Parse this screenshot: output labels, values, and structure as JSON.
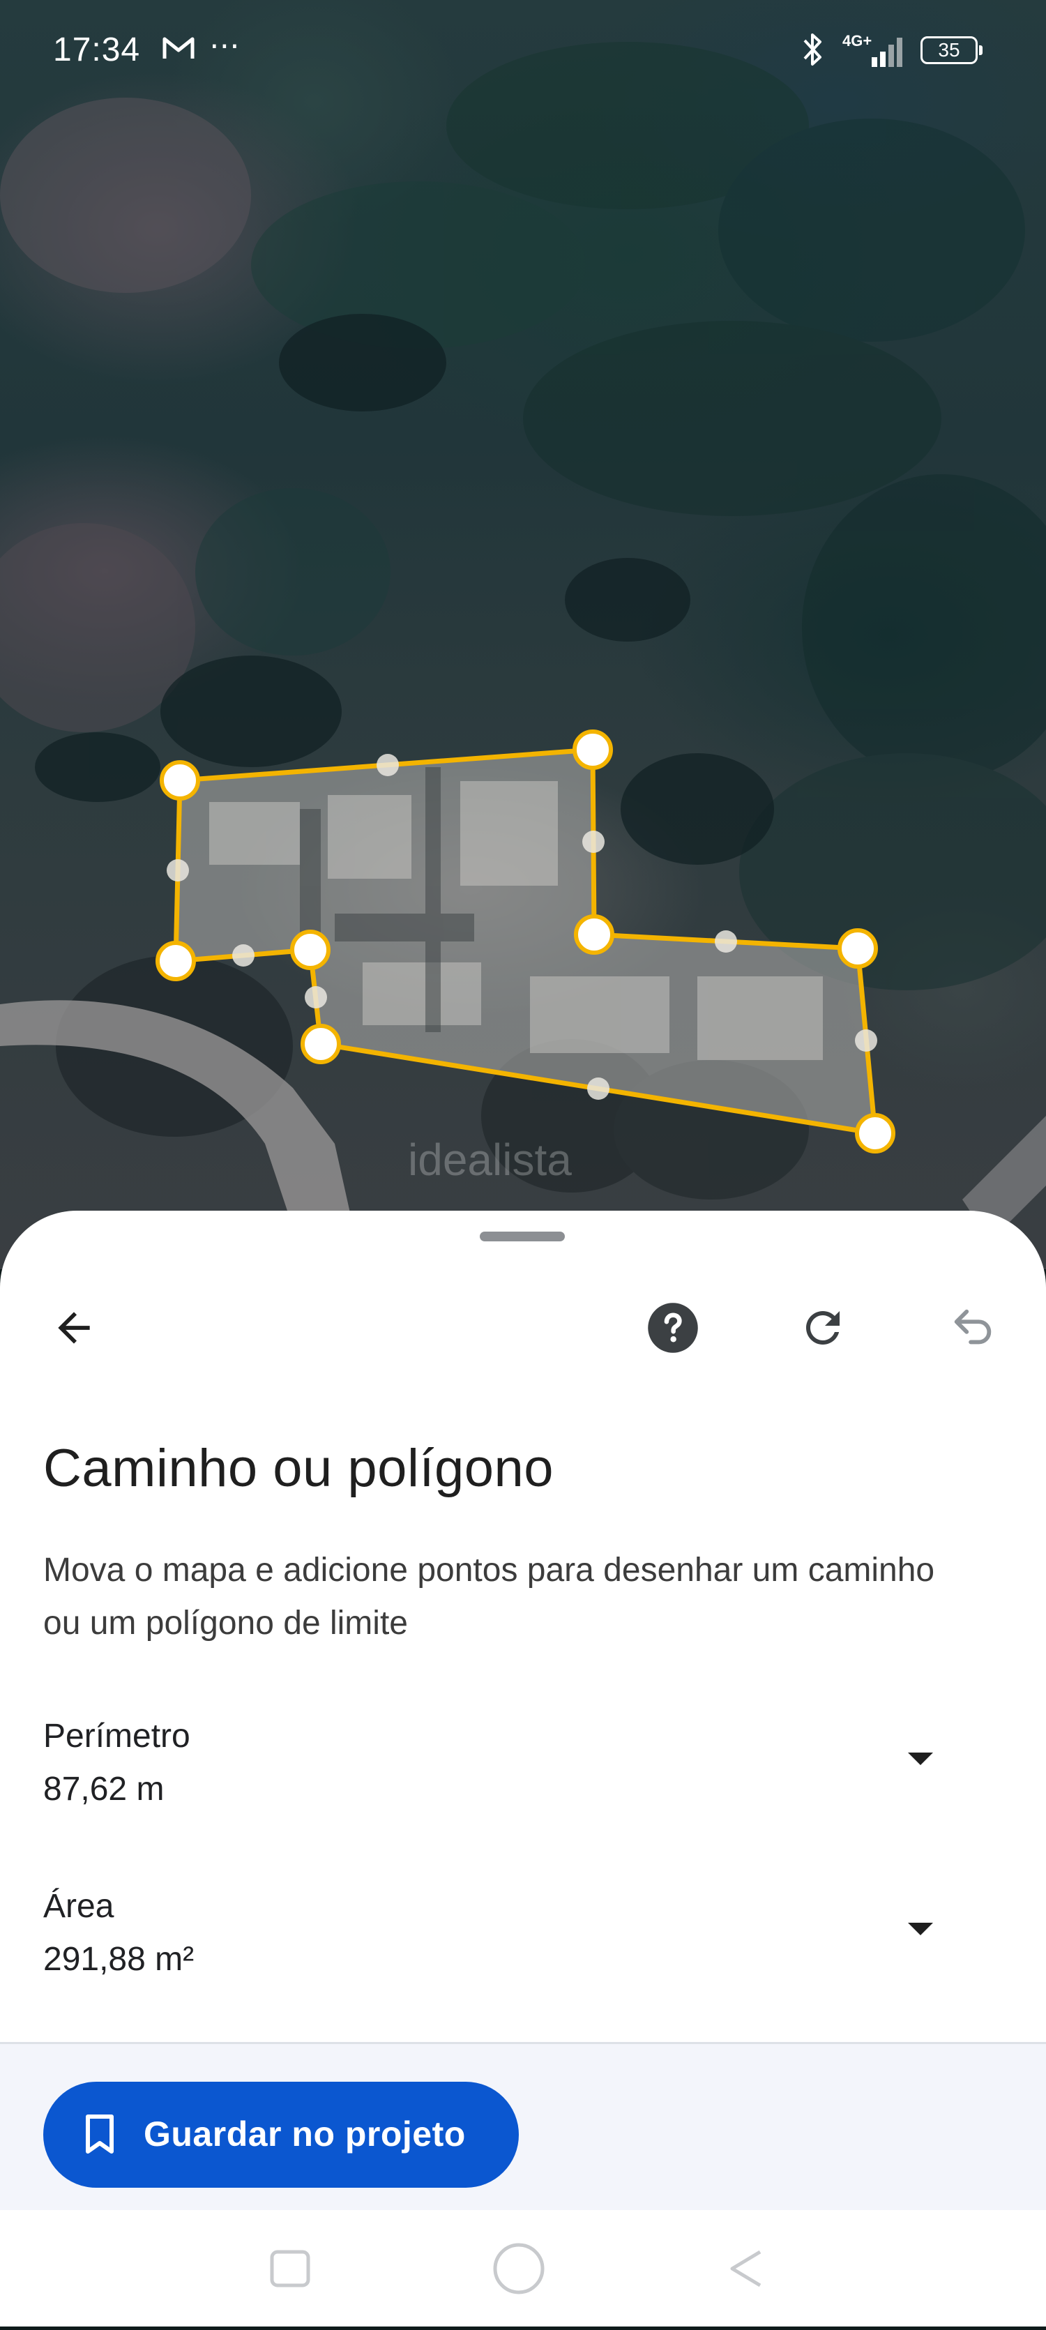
{
  "status_bar": {
    "time": "17:34",
    "battery": "35",
    "network": "4G+"
  },
  "map": {
    "watermark": "idealista",
    "line_color": "#f4b400"
  },
  "sheet": {
    "title": "Caminho ou polígono",
    "description": "Mova o mapa e adicione pontos para desenhar um caminho ou um polígono de limite",
    "perimeter": {
      "label": "Perímetro",
      "value": "87,62 m"
    },
    "area": {
      "label": "Área",
      "value": "291,88 m²"
    },
    "save_label": "Guardar no projeto"
  },
  "colors": {
    "primary": "#0b57d0",
    "text": "#1f1f1f",
    "footer_bg": "#f3f5fb"
  },
  "icons": [
    "arrow-left-icon",
    "help-icon",
    "redo-icon",
    "undo-icon",
    "chevron-down-icon",
    "bookmark-icon",
    "mail-icon",
    "bluetooth-icon",
    "signal-icon",
    "battery-icon"
  ]
}
